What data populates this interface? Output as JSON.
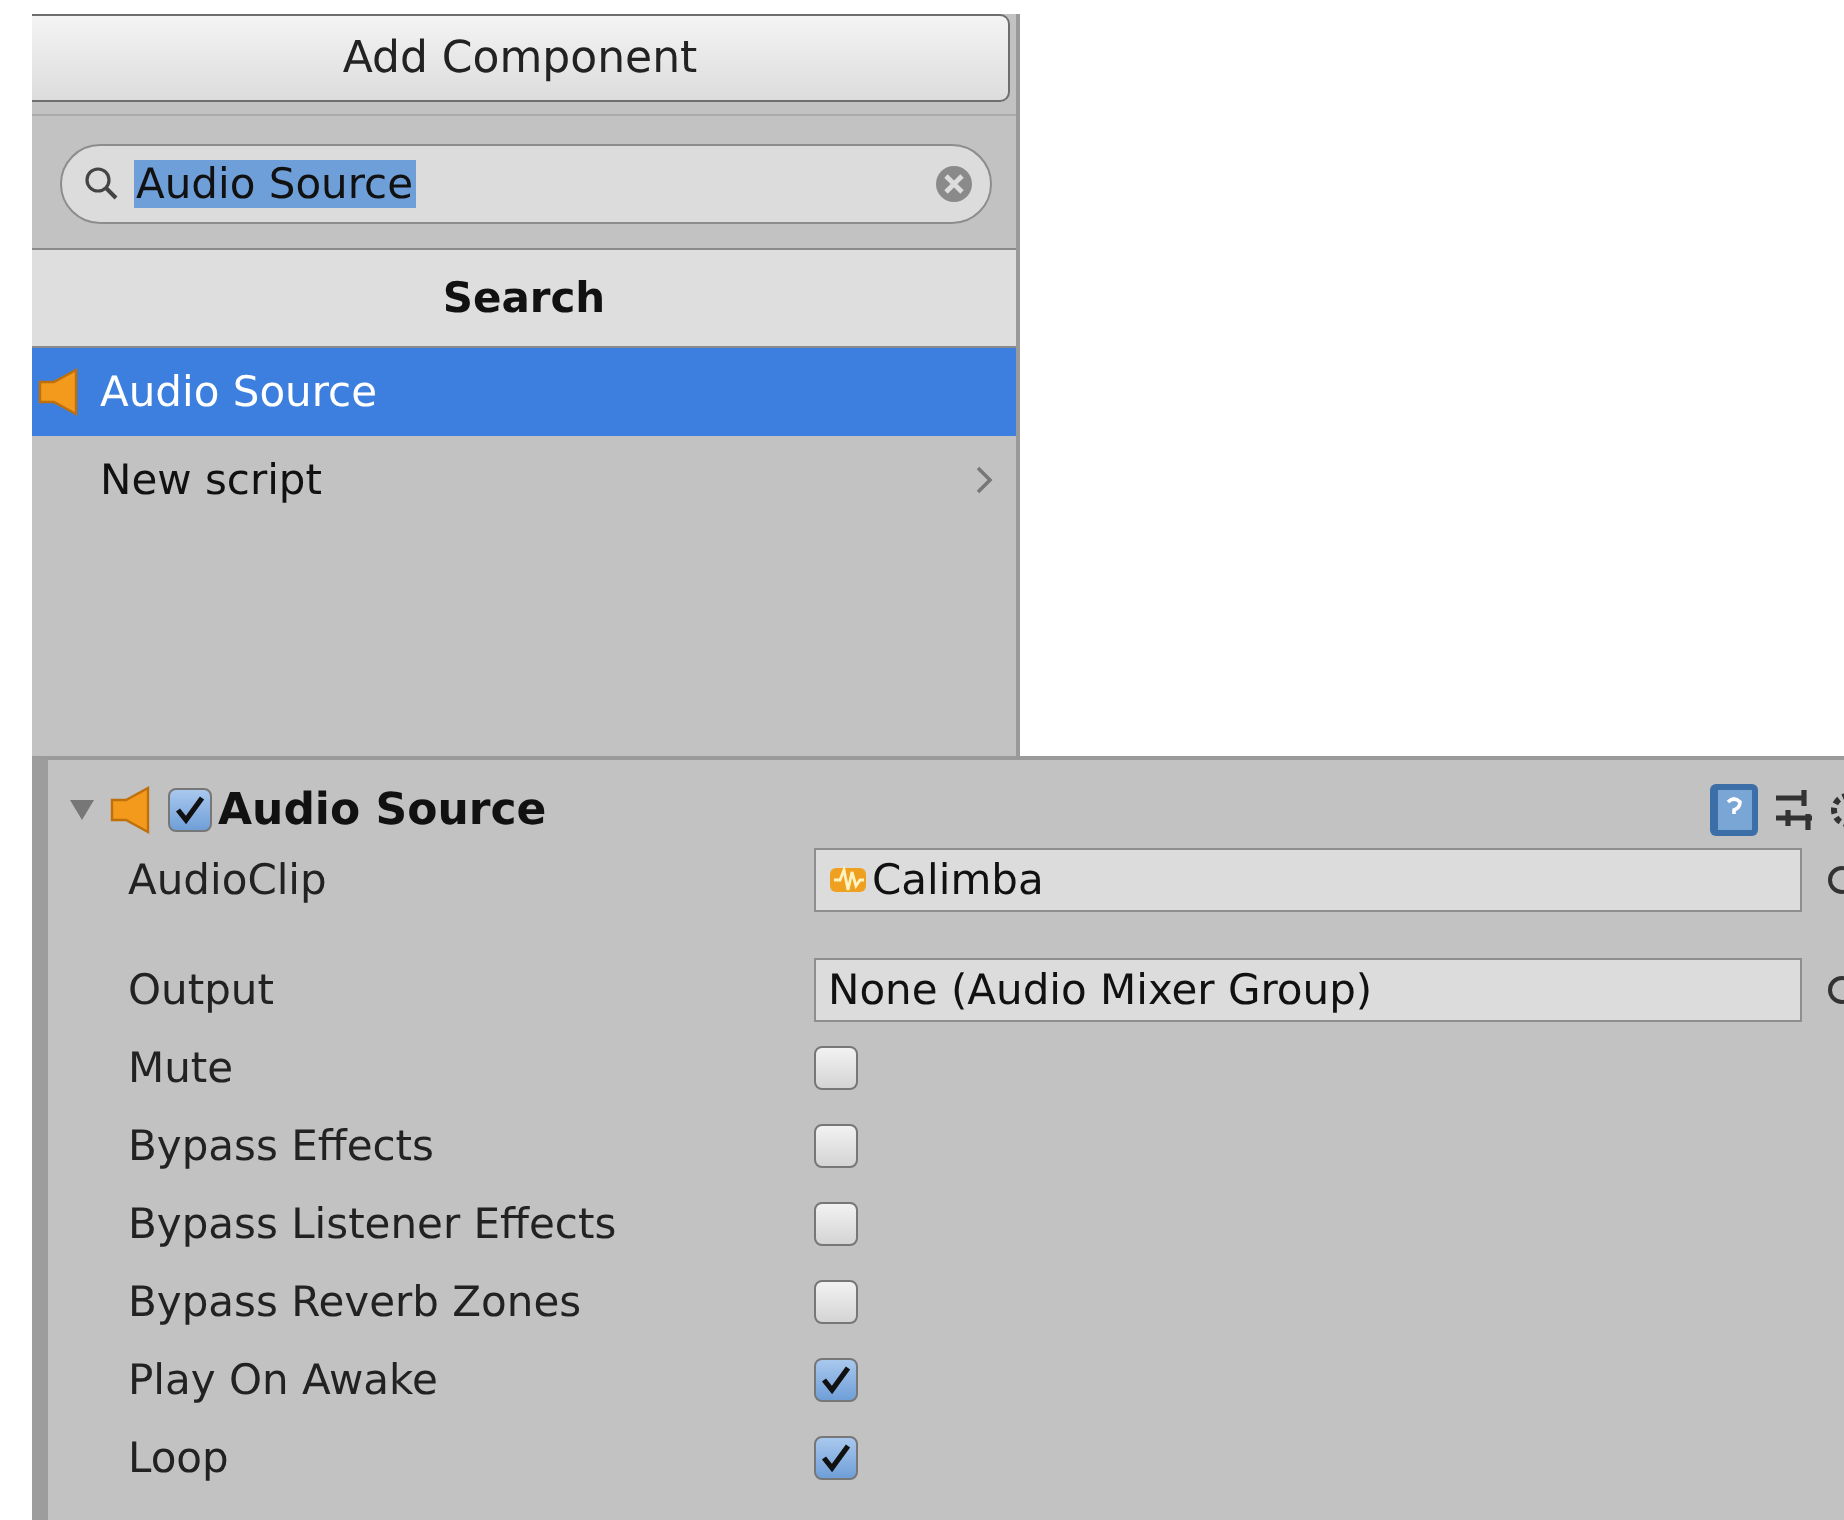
{
  "add_component": {
    "button": "Add Component",
    "search": {
      "value": "Audio Source"
    },
    "header": "Search",
    "items": [
      {
        "label": "Audio Source",
        "kind": "component",
        "selected": true
      },
      {
        "label": "New script",
        "kind": "submenu",
        "selected": false
      }
    ]
  },
  "inspector": {
    "title": "Audio Source",
    "expanded": true,
    "enabled": true,
    "fields": [
      {
        "kind": "clip",
        "label": "AudioClip",
        "value": "Calimba"
      },
      {
        "kind": "object",
        "label": "Output",
        "value": "None (Audio Mixer Group)"
      },
      {
        "kind": "checkbox",
        "label": "Mute",
        "checked": false
      },
      {
        "kind": "checkbox",
        "label": "Bypass Effects",
        "checked": false
      },
      {
        "kind": "checkbox",
        "label": "Bypass Listener Effects",
        "checked": false
      },
      {
        "kind": "checkbox",
        "label": "Bypass Reverb Zones",
        "checked": false
      },
      {
        "kind": "checkbox",
        "label": "Play On Awake",
        "checked": true
      },
      {
        "kind": "checkbox",
        "label": "Loop",
        "checked": true
      }
    ]
  }
}
